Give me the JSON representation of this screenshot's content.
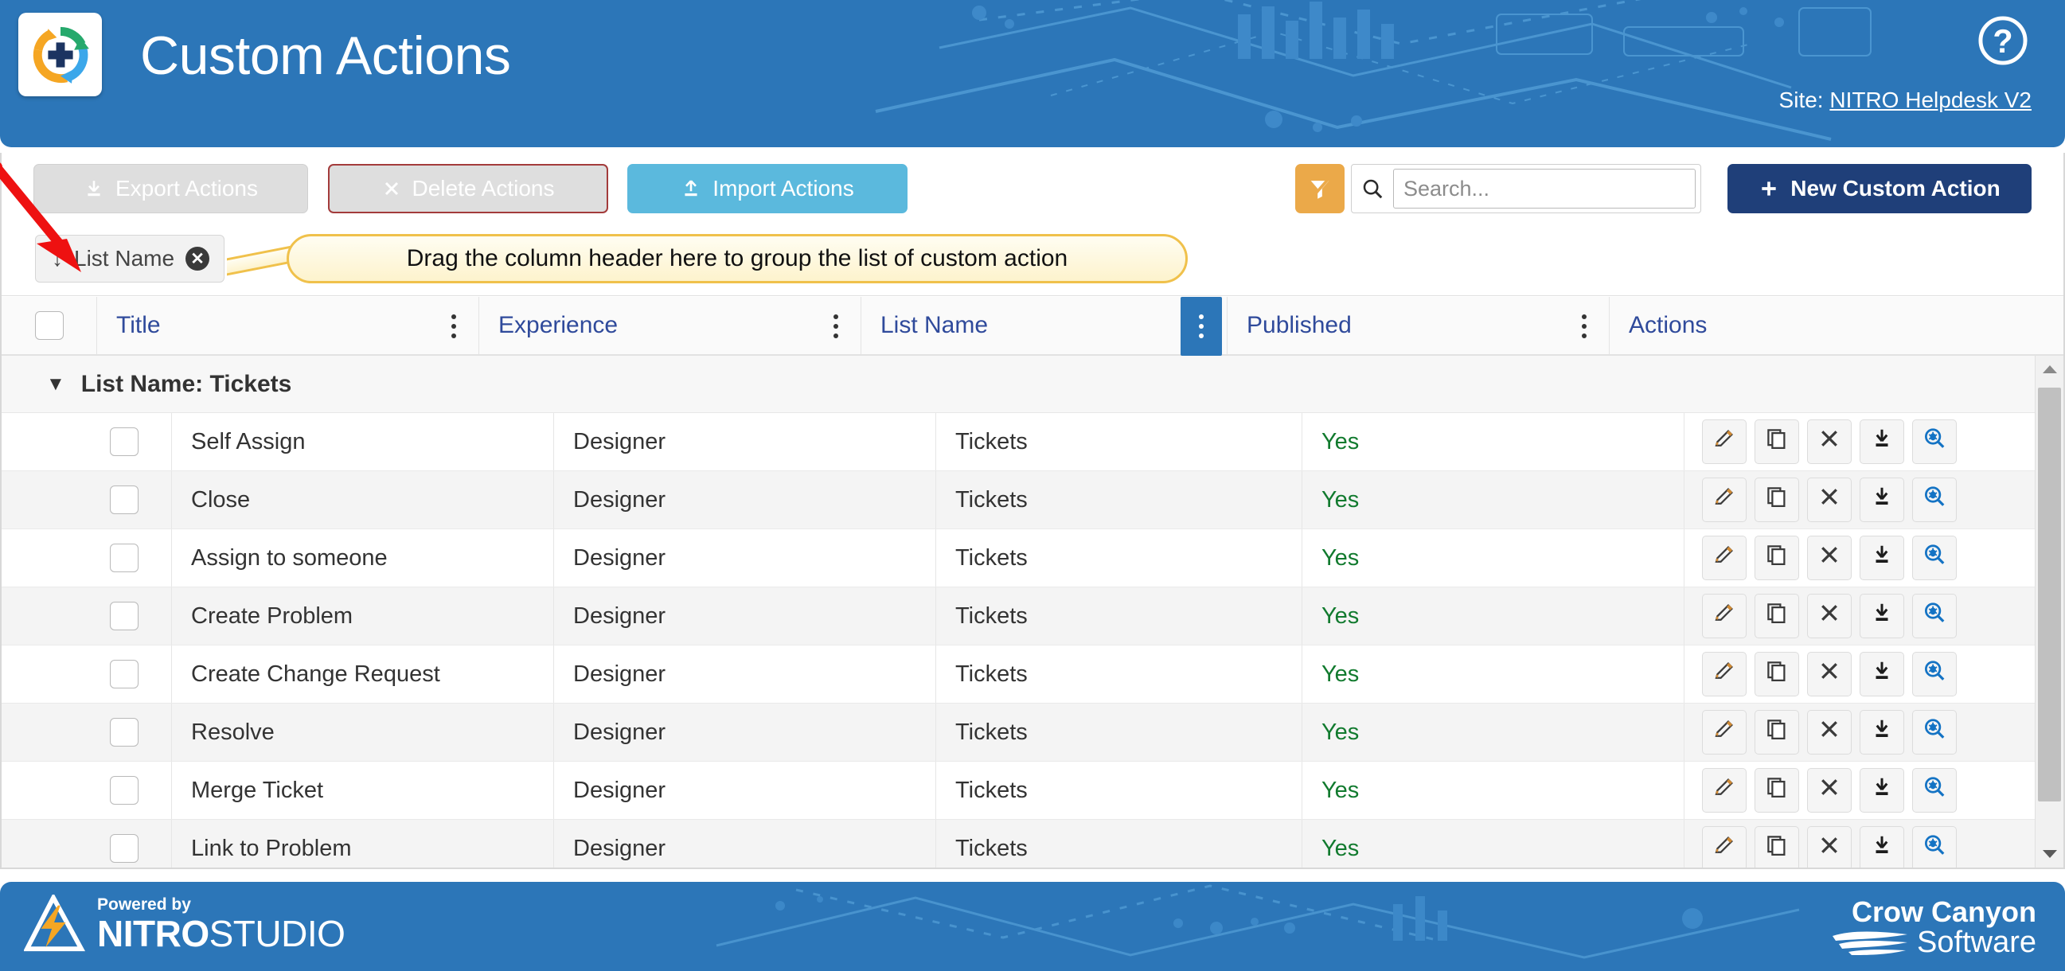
{
  "header": {
    "title": "Custom Actions",
    "logo_icon": "circular-arrows-plus-logo",
    "help_icon": "help-question-circle-icon",
    "site_prefix": "Site:",
    "site_link": "NITRO Helpdesk V2",
    "bg_color": "#2c76b8"
  },
  "toolbar": {
    "export_label": "Export Actions",
    "export_icon": "download-icon",
    "delete_label": "Delete Actions",
    "delete_icon": "close-x-icon",
    "import_label": "Import Actions",
    "import_icon": "upload-icon",
    "new_label": "New Custom Action",
    "new_icon": "plus-icon",
    "filter_icon": "clear-filter-funnel-icon",
    "search_icon": "search-icon",
    "search_value": "",
    "search_placeholder": "Search...",
    "colors": {
      "import": "#5bb9dd",
      "new": "#1f3f79",
      "filter": "#eba949",
      "delete_border": "#a33b3b"
    }
  },
  "group_bar": {
    "chip_arrow": "↓",
    "chip_label": "List Name",
    "chip_remove_icon": "remove-circle-icon",
    "callout_text": "Drag the column header here to group the list of custom action",
    "callout_border": "#f0c14b"
  },
  "table": {
    "select_all_checkbox_icon": "checkbox-icon",
    "columns": [
      {
        "label": "Title",
        "menu_icon": "column-menu-kebab-icon",
        "active": false
      },
      {
        "label": "Experience",
        "menu_icon": "column-menu-kebab-icon",
        "active": false
      },
      {
        "label": "List Name",
        "menu_icon": "column-menu-kebab-icon",
        "active": true
      },
      {
        "label": "Published",
        "menu_icon": "column-menu-kebab-icon",
        "active": false
      },
      {
        "label": "Actions",
        "menu_icon": "",
        "active": false
      }
    ],
    "group_row": {
      "caret_icon": "caret-down-icon",
      "label": "List Name: Tickets"
    },
    "row_action_icons": [
      "edit-pencil-icon",
      "copy-duplicate-icon",
      "delete-x-icon",
      "export-download-icon",
      "debug-magnifier-icon"
    ],
    "rows": [
      {
        "title": "Self Assign",
        "experience": "Designer",
        "list_name": "Tickets",
        "published": "Yes"
      },
      {
        "title": "Close",
        "experience": "Designer",
        "list_name": "Tickets",
        "published": "Yes"
      },
      {
        "title": "Assign to someone",
        "experience": "Designer",
        "list_name": "Tickets",
        "published": "Yes"
      },
      {
        "title": "Create Problem",
        "experience": "Designer",
        "list_name": "Tickets",
        "published": "Yes"
      },
      {
        "title": "Create Change Request",
        "experience": "Designer",
        "list_name": "Tickets",
        "published": "Yes"
      },
      {
        "title": "Resolve",
        "experience": "Designer",
        "list_name": "Tickets",
        "published": "Yes"
      },
      {
        "title": "Merge Ticket",
        "experience": "Designer",
        "list_name": "Tickets",
        "published": "Yes"
      },
      {
        "title": "Link to Problem",
        "experience": "Designer",
        "list_name": "Tickets",
        "published": "Yes"
      }
    ],
    "scrollbar": {
      "up_icon": "scroll-up-arrow-icon",
      "down_icon": "scroll-down-arrow-icon"
    },
    "published_color": "#117a2e"
  },
  "footer": {
    "powered_by": "Powered by",
    "nitro_bold": "NITRO",
    "nitro_light": "STUDIO",
    "nitro_icon": "nitro-lightning-bolt-icon",
    "crow_line1": "Crow Canyon",
    "crow_line2": "Software",
    "crow_icon": "crow-canyon-wave-icon",
    "bg_color": "#2c76b8"
  },
  "annotation": {
    "arrow_icon": "red-pointer-arrow",
    "arrow_color": "#ee1111"
  }
}
